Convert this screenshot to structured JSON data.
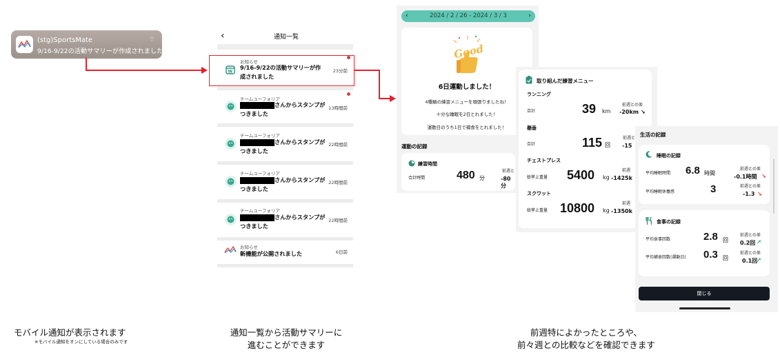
{
  "notification": {
    "app_name": "(stg)SportsMate",
    "message": "9/16-9/22の活動サマリーが作成されました",
    "badge": "⌔"
  },
  "list": {
    "back": "‹",
    "title": "通知一覧",
    "items": [
      {
        "category": "お知らせ",
        "message": "9/16-9/22の活動サマリーが作成されました",
        "time": "23分前",
        "icon": "calendar-icon"
      },
      {
        "category": "チームユーフォリア",
        "message_suffix": "さんからスタンプがつきました",
        "time": "13時間前",
        "icon": "stamp-icon"
      },
      {
        "category": "チームユーフォリア",
        "message_suffix": "さんからスタンプがつきました",
        "time": "22時間前",
        "icon": "stamp-icon"
      },
      {
        "category": "チームユーフォリア",
        "message_suffix": "さんからスタンプがつきました",
        "time": "22時間前",
        "icon": "stamp-icon"
      },
      {
        "category": "チームユーフォリア",
        "message_suffix": "さんからスタンプがつきました",
        "time": "22時間前",
        "icon": "stamp-icon"
      },
      {
        "category": "お知らせ",
        "message": "新機能が公開されました",
        "time": "6日前",
        "icon": "app-logo-icon"
      }
    ]
  },
  "summary": {
    "date_range": "2024 / 2 / 26 - 2024 / 3 / 3",
    "prev": "‹",
    "next": "›",
    "good_text": "Good",
    "headline": "6日運動しました！",
    "line1": "4種類の練習メニューを頑張りましたね！",
    "line2": "十分な睡眠を2日とれました！",
    "line3": "運動日のうち1日で補食をとれました！",
    "exercise_section": "運動の記録",
    "practice_time_title": "練習時間",
    "total_time_label": "合計時間",
    "total_time_value": "480",
    "total_time_unit": "分",
    "prev_week_label": "前週と",
    "prev_week_diff": "-80分"
  },
  "menu": {
    "title": "取り組んだ練習メニュー",
    "items": [
      {
        "name": "ランニング",
        "label": "合計",
        "value": "39",
        "unit": "km",
        "diff_label": "前週との差",
        "diff": "-20km ↘"
      },
      {
        "name": "懸垂",
        "label": "合計",
        "value": "115",
        "unit": "回",
        "diff_label": "前週と",
        "diff": "-15"
      },
      {
        "name": "チェストプレス",
        "label": "総挙上重量",
        "value": "5400",
        "unit": "kg",
        "diff_label": "前週",
        "diff": "-1425k"
      },
      {
        "name": "スクワット",
        "label": "総挙上重量",
        "value": "10800",
        "unit": "kg",
        "diff_label": "前週",
        "diff": "-1350k"
      }
    ]
  },
  "life": {
    "title": "生活の記録",
    "sleep_title": "睡眠の記録",
    "sleep_rows": [
      {
        "label": "平均睡眠時間",
        "value": "6.8",
        "unit": "時間",
        "diff_label": "前週との差",
        "diff": "-0.1時間",
        "trend": "↘",
        "color": "#d6352f"
      },
      {
        "label": "平均睡眠休養感",
        "value": "3",
        "unit": "",
        "diff_label": "前週との差",
        "diff": "-1.3",
        "trend": "↘",
        "color": "#d6352f"
      }
    ],
    "meal_title": "食事の記録",
    "meal_rows": [
      {
        "label": "平均食事回数",
        "value": "2.8",
        "unit": "回",
        "diff_label": "前週との差",
        "diff": "0.2回",
        "trend": "↗",
        "color": "#27a37c"
      },
      {
        "label": "平均補食回数(運動日)",
        "value": "0.3",
        "unit": "回",
        "diff_label": "前週との差",
        "diff": "0.1回",
        "trend": "↗",
        "color": "#27a37c"
      }
    ],
    "close_button": "閉じる"
  },
  "captions": {
    "c1": "モバイル通知が表示されます",
    "c1_note": "※モバイル通知をオンにしている場合のみです",
    "c2_line1": "通知一覧から活動サマリーに",
    "c2_line2": "進むことができます",
    "c3_line1": "前週特によかったところや、",
    "c3_line2": "前々週との比較などを確認できます"
  },
  "colors": {
    "accent": "#5fc6b4",
    "connector": "#e61e2a",
    "down": "#d6352f",
    "up": "#27a37c"
  }
}
